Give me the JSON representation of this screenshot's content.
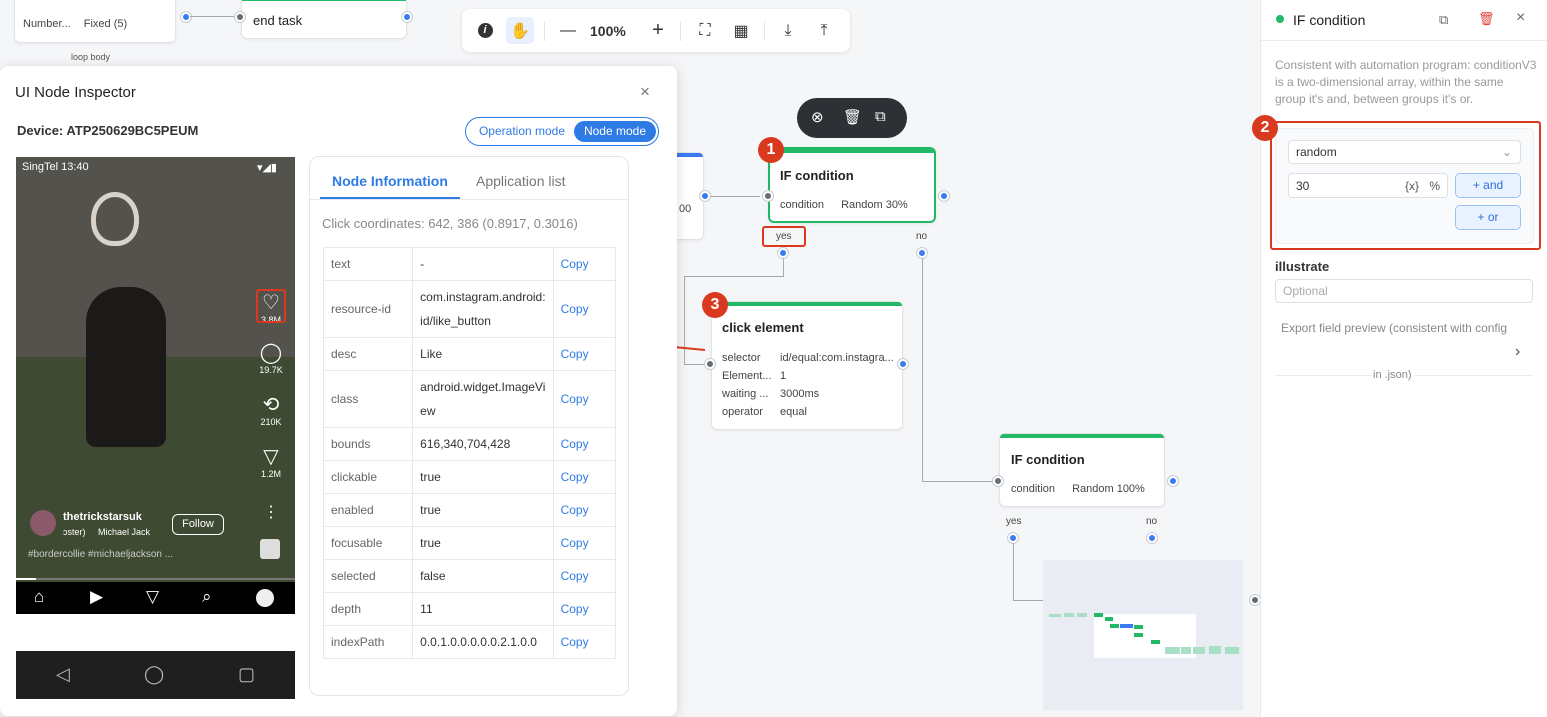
{
  "canvas": {
    "loop_node": {
      "row1_key": "Number...",
      "row1_val": "Fixed (5)",
      "label": "loop body"
    },
    "end_task": {
      "title": "end task"
    },
    "partial_value": "00",
    "if1": {
      "title": "IF condition",
      "key": "condition",
      "val": "Random 30%",
      "yes": "yes",
      "no": "no"
    },
    "click": {
      "title": "click element",
      "rows": [
        {
          "k": "selector",
          "v": "id/equal:com.instagra..."
        },
        {
          "k": "Element...",
          "v": "1"
        },
        {
          "k": "waiting ...",
          "v": "3000ms"
        },
        {
          "k": "operator",
          "v": "equal"
        }
      ]
    },
    "if2": {
      "title": "IF condition",
      "key": "condition",
      "val": "Random 100%",
      "yes": "yes",
      "no": "no"
    }
  },
  "toolbar": {
    "info_icon": "info-icon",
    "hand_icon": "hand-icon",
    "zoom": "100%"
  },
  "inspector": {
    "title": "UI Node Inspector",
    "device": "Device: ATP250629BC5PEUM",
    "modes": [
      "Operation mode",
      "Node mode"
    ],
    "active_mode": "Node mode",
    "tabs": [
      "Node Information",
      "Application list"
    ],
    "coords": "Click coordinates: 642, 386 (0.8917, 0.3016)",
    "copy_label": "Copy",
    "props": [
      {
        "k": "text",
        "v": "-"
      },
      {
        "k": "resource-id",
        "v": "com.instagram.android:\nid/like_button"
      },
      {
        "k": "desc",
        "v": "Like"
      },
      {
        "k": "class",
        "v": "android.widget.ImageVi\new"
      },
      {
        "k": "bounds",
        "v": "616,340,704,428"
      },
      {
        "k": "clickable",
        "v": "true"
      },
      {
        "k": "enabled",
        "v": "true"
      },
      {
        "k": "focusable",
        "v": "true"
      },
      {
        "k": "selected",
        "v": "false"
      },
      {
        "k": "depth",
        "v": "11"
      },
      {
        "k": "indexPath",
        "v": "0.0.1.0.0.0.0.0.2.1.0.0"
      }
    ]
  },
  "phone": {
    "status": "SingTel 13:40",
    "rail": [
      "3.8M",
      "19.7K",
      "210K",
      "1.2M"
    ],
    "username": "thetrickstarsuk",
    "follow": "Follow",
    "audio": "ɔster)     Michael Jack",
    "hashtags": "#bordercollie #michaeljackson ..."
  },
  "panel": {
    "title": "IF condition",
    "description": "Consistent with automation program: conditionV3 is a two-dimensional array, within the same group it's and, between groups it's or.",
    "select_value": "random",
    "number_value": "30",
    "var_icon": "{x}",
    "percent": "%",
    "and_label": "+ and",
    "or_label": "+ or",
    "illustrate_label": "illustrate",
    "illustrate_placeholder": "Optional",
    "export_label": "Export field preview (consistent with config",
    "export_label2": "in .json)"
  },
  "markers": [
    "1",
    "2",
    "3"
  ],
  "colors": {
    "accent": "#2f7be6",
    "green": "#21b866",
    "marker": "#d9391f"
  }
}
